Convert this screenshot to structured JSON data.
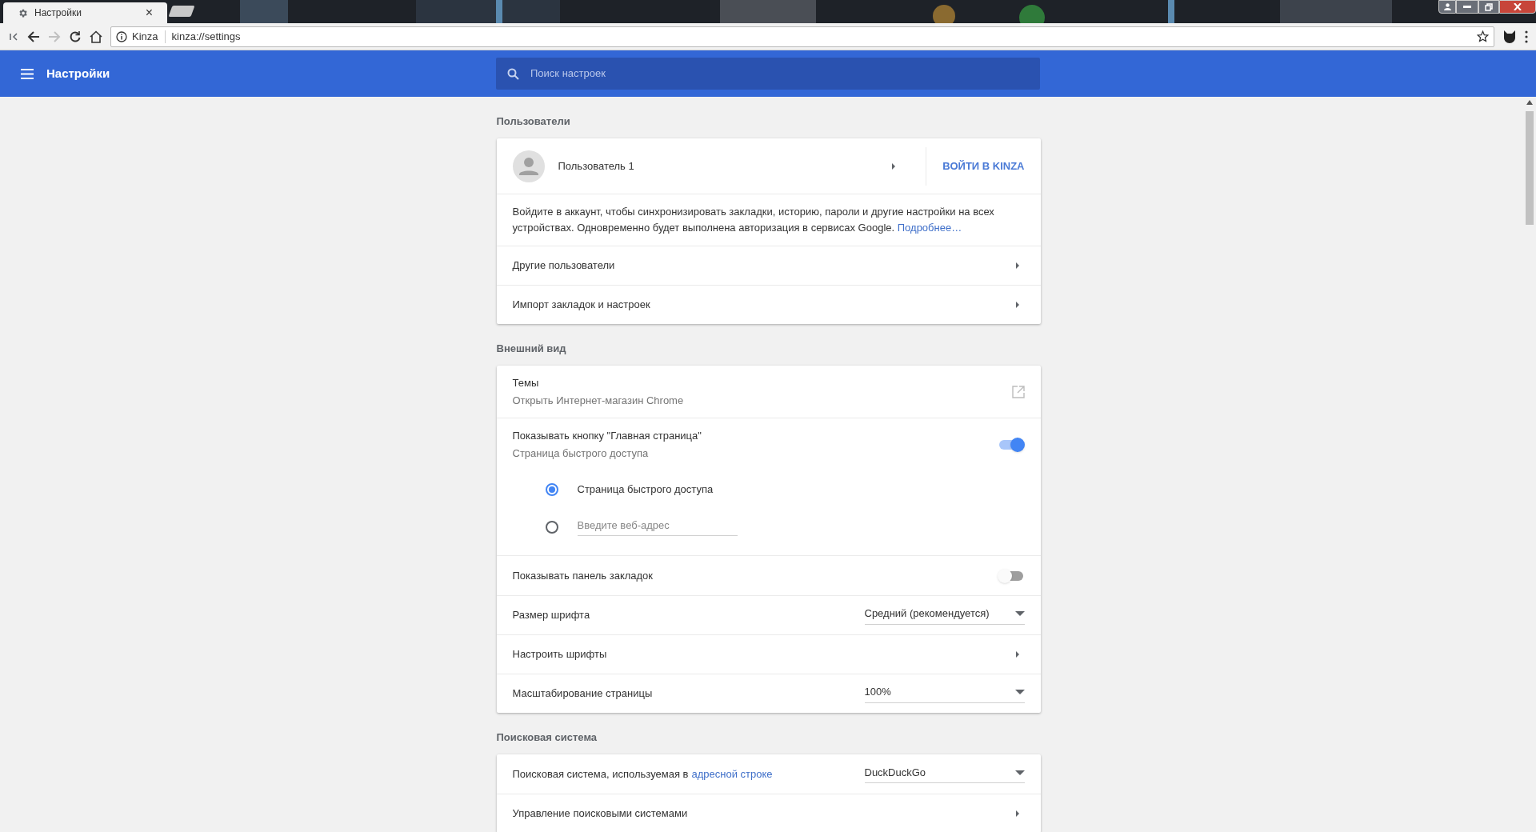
{
  "tabs": [
    {
      "title": "Настройки",
      "close": "×",
      "selected": true
    },
    {
      "selected": false
    }
  ],
  "address_bar": {
    "site": "Kinza",
    "url": "kinza://settings"
  },
  "header": {
    "title": "Настройки",
    "search_placeholder": "Поиск настроек"
  },
  "sections": [
    {
      "title": "Пользователи",
      "rows": [
        {
          "kind": "user",
          "label": "Пользователь 1",
          "button": "ВОЙТИ В KINZA"
        },
        {
          "kind": "paragraph",
          "text": "Войдите в аккаунт, чтобы синхронизировать закладки, историю, пароли и другие настройки на всех устройствах. Одновременно будет выполнена авторизация в сервисах Google.",
          "link": "Подробнее…"
        },
        {
          "kind": "arrow",
          "label": "Другие пользователи"
        },
        {
          "kind": "arrow",
          "label": "Импорт закладок и настроек"
        }
      ]
    },
    {
      "title": "Внешний вид",
      "rows": [
        {
          "kind": "external",
          "label": "Темы",
          "sublabel": "Открыть Интернет-магазин Chrome"
        },
        {
          "kind": "toggle",
          "label": "Показывать кнопку \"Главная страница\"",
          "sublabel": "Страница быстрого доступа",
          "on": true,
          "options": [
            {
              "kind": "label",
              "label": "Страница быстрого доступа",
              "selected": true
            },
            {
              "kind": "input",
              "placeholder": "Введите веб-адрес",
              "selected": false
            }
          ]
        },
        {
          "kind": "toggle",
          "label": "Показывать панель закладок",
          "on": false
        },
        {
          "kind": "select",
          "label": "Размер шрифта",
          "value": "Средний (рекомендуется)"
        },
        {
          "kind": "arrow",
          "label": "Настроить шрифты"
        },
        {
          "kind": "select",
          "label": "Масштабирование страницы",
          "value": "100%"
        }
      ]
    },
    {
      "title": "Поисковая система",
      "rows": [
        {
          "kind": "select",
          "label": "Поисковая система, используемая в",
          "link": "адресной строке",
          "value": "DuckDuckGo"
        },
        {
          "kind": "arrow",
          "label": "Управление поисковыми системами"
        }
      ]
    }
  ]
}
